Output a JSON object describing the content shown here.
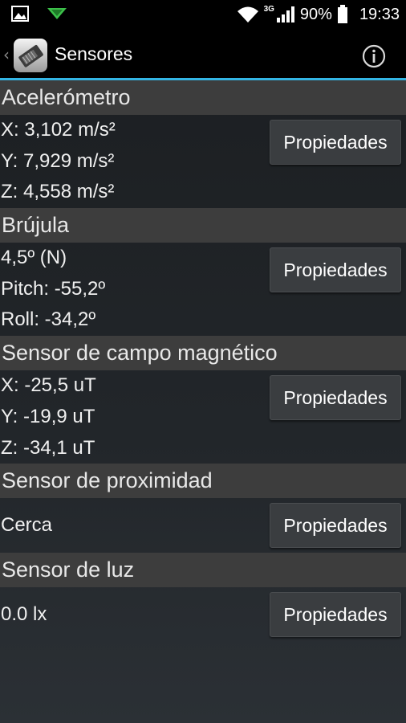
{
  "status_bar": {
    "signal_type": "3G",
    "battery": "90%",
    "time": "19:33",
    "icons": [
      "image-icon",
      "download-arrow-icon",
      "wifi-icon",
      "signal-icon",
      "battery-icon"
    ]
  },
  "action_bar": {
    "title": "Sensores",
    "accent_color": "#33b5e5"
  },
  "button_label": "Propiedades",
  "sensors": [
    {
      "header": "Acelerómetro",
      "values": [
        "X: 3,102 m/s²",
        "Y: 7,929 m/s²",
        "Z: 4,558 m/s²"
      ],
      "button": "Propiedades"
    },
    {
      "header": "Brújula",
      "values": [
        "4,5º (N)",
        "Pitch: -55,2º",
        "Roll: -34,2º"
      ],
      "button": "Propiedades"
    },
    {
      "header": "Sensor de campo magnético",
      "values": [
        "X: -25,5 uT",
        "Y: -19,9 uT",
        "Z: -34,1 uT"
      ],
      "button": "Propiedades"
    },
    {
      "header": "Sensor de proximidad",
      "values": [
        "Cerca"
      ],
      "button": "Propiedades"
    },
    {
      "header": "Sensor de luz",
      "values": [
        "0.0 lx"
      ],
      "button": "Propiedades"
    }
  ]
}
